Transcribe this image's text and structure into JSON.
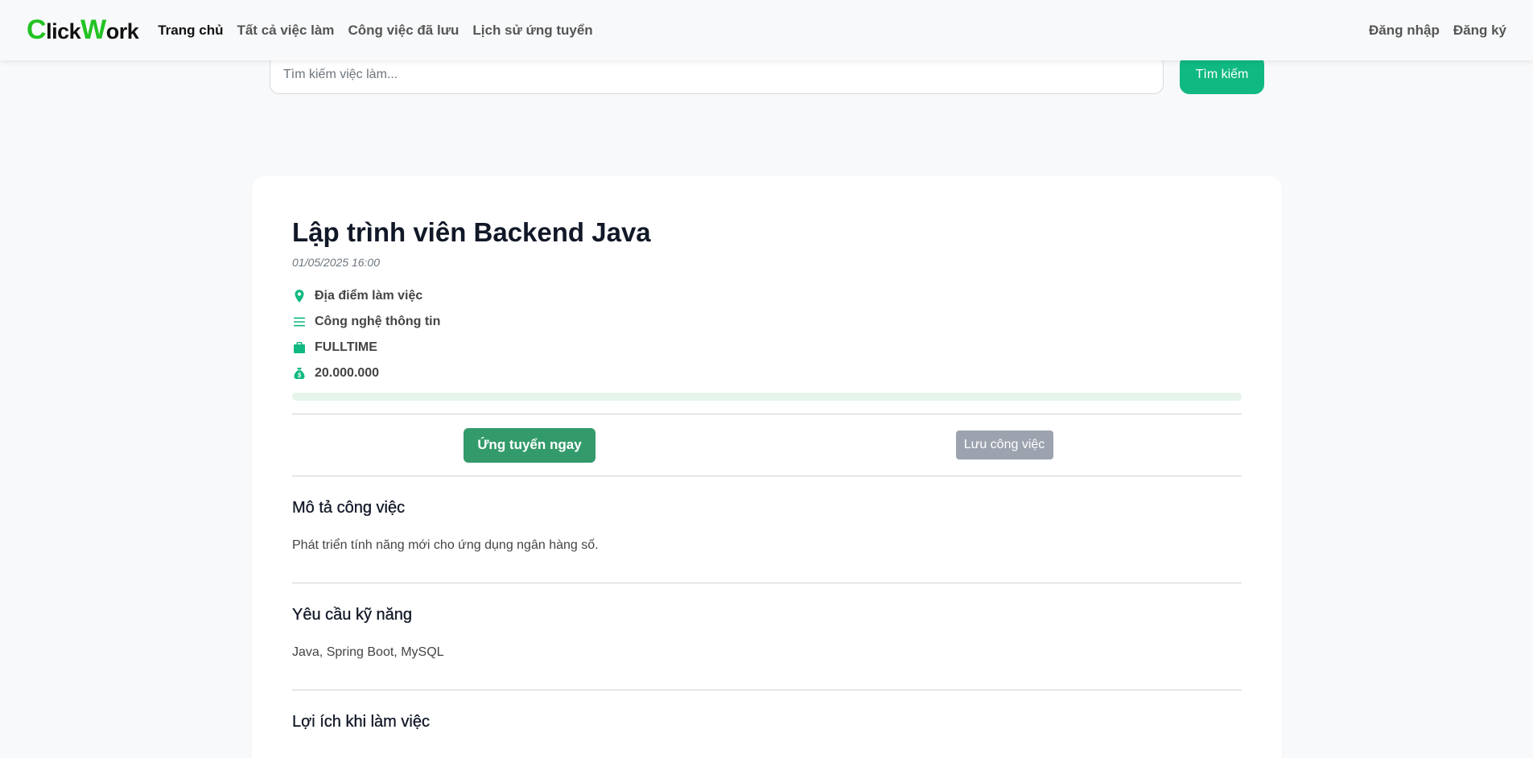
{
  "navbar": {
    "brand_first": "C",
    "brand_mid": "lick",
    "brand_w": "W",
    "brand_rest": "ork",
    "links": [
      "Trang chủ",
      "Tất cả việc làm",
      "Công việc đã lưu",
      "Lịch sử ứng tuyển"
    ],
    "login": "Đăng nhập",
    "register": "Đăng ký"
  },
  "search": {
    "placeholder": "Tìm kiếm việc làm...",
    "button": "Tìm kiếm"
  },
  "job": {
    "title": "Lập trình viên Backend Java",
    "date": "01/05/2025 16:00",
    "location": "Địa điểm làm việc",
    "category": "Công nghệ thông tin",
    "type": "FULLTIME",
    "salary": "20.000.000",
    "progress": 0,
    "apply_label": "Ứng tuyển ngay",
    "save_label": "Lưu công việc"
  },
  "sections": {
    "description": {
      "heading": "Mô tả công việc",
      "body": "Phát triển tính năng mới cho ứng dụng ngân hàng số."
    },
    "skills": {
      "heading": "Yêu cầu kỹ năng",
      "body": "Java, Spring Boot, MySQL"
    },
    "benefits": {
      "heading": "Lợi ích khi làm việc"
    }
  },
  "icons": {
    "location": "map-pin-icon",
    "category": "list-icon",
    "type": "briefcase-icon",
    "salary": "money-bag-icon"
  },
  "colors": {
    "accent": "#10b981",
    "apply": "#339b6b",
    "save": "#9ca3af",
    "brand_green": "#22c322"
  }
}
